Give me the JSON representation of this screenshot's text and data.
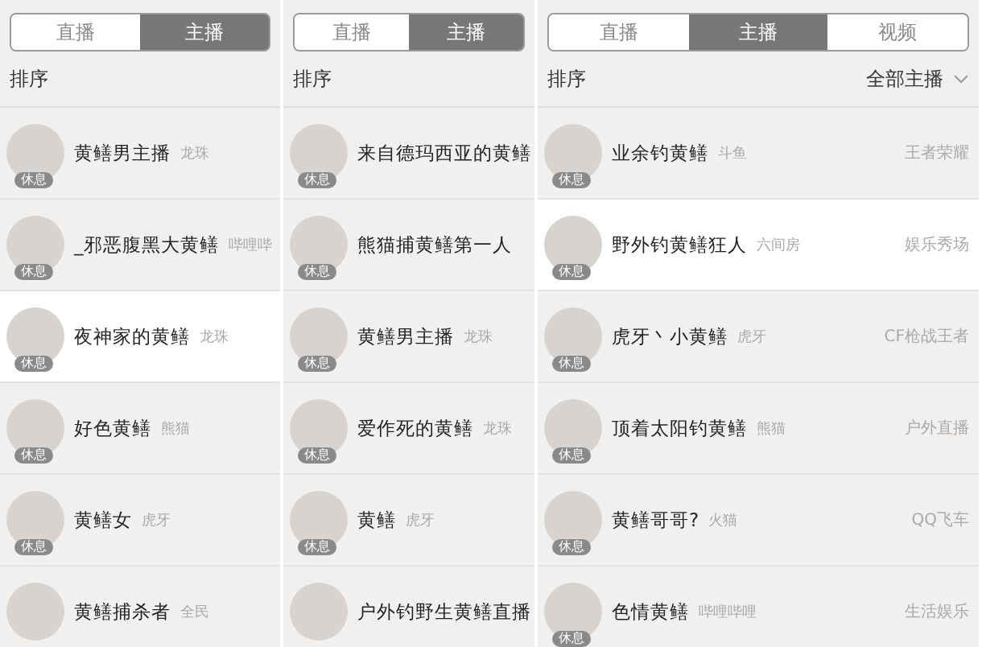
{
  "panels": [
    {
      "tabs": [
        {
          "label": "直播",
          "selected": false
        },
        {
          "label": "主播",
          "selected": true
        }
      ],
      "sort_label": "排序",
      "rows": [
        {
          "name": "黄鳝男主播",
          "platform": "龙珠",
          "badge": "休息",
          "highlighted": false
        },
        {
          "name": "_邪恶腹黑大黄鳝",
          "platform": "哔哩哔",
          "badge": "休息",
          "highlighted": false
        },
        {
          "name": "夜神家的黄鳝",
          "platform": "龙珠",
          "badge": "休息",
          "highlighted": true
        },
        {
          "name": "好色黄鳝",
          "platform": "熊猫",
          "badge": "休息",
          "highlighted": false
        },
        {
          "name": "黄鳝女",
          "platform": "虎牙",
          "badge": "休息",
          "highlighted": false
        },
        {
          "name": "黄鳝捕杀者",
          "platform": "全民",
          "highlighted": false
        }
      ]
    },
    {
      "tabs": [
        {
          "label": "直播",
          "selected": false
        },
        {
          "label": "主播",
          "selected": true
        }
      ],
      "sort_label": "排序",
      "rows": [
        {
          "name": "来自德玛西亚的黄鳝",
          "badge": "休息",
          "highlighted": false
        },
        {
          "name": "熊猫捕黄鳝第一人",
          "badge": "休息",
          "highlighted": false
        },
        {
          "name": "黄鳝男主播",
          "platform": "龙珠",
          "badge": "休息",
          "highlighted": false
        },
        {
          "name": "爱作死的黄鳝",
          "platform": "龙珠",
          "badge": "休息",
          "highlighted": false
        },
        {
          "name": "黄鳝",
          "platform": "虎牙",
          "badge": "休息",
          "highlighted": false
        },
        {
          "name": "户外钓野生黄鳝直播",
          "highlighted": false
        }
      ]
    },
    {
      "tabs": [
        {
          "label": "直播",
          "selected": false
        },
        {
          "label": "主播",
          "selected": true
        },
        {
          "label": "视频",
          "selected": false
        }
      ],
      "sort_label": "排序",
      "filter": {
        "label": "全部主播"
      },
      "rows": [
        {
          "name": "业余钓黄鳝",
          "platform": "斗鱼",
          "category": "王者荣耀",
          "badge": "休息",
          "highlighted": false
        },
        {
          "name": "野外钓黄鳝狂人",
          "platform": "六间房",
          "category": "娱乐秀场",
          "badge": "休息",
          "highlighted": true
        },
        {
          "name": "虎牙丶小黄鳝",
          "platform": "虎牙",
          "category": "CF枪战王者",
          "badge": "休息",
          "highlighted": false
        },
        {
          "name": "顶着太阳钓黄鳝",
          "platform": "熊猫",
          "category": "户外直播",
          "badge": "休息",
          "highlighted": false
        },
        {
          "name": "黄鳝哥哥?",
          "platform": "火猫",
          "category": "QQ飞车",
          "badge": "休息",
          "highlighted": false
        },
        {
          "name": "色情黄鳝",
          "platform": "哔哩哔哩",
          "category": "生活娱乐",
          "badge": "休息",
          "highlighted": false
        }
      ]
    }
  ]
}
